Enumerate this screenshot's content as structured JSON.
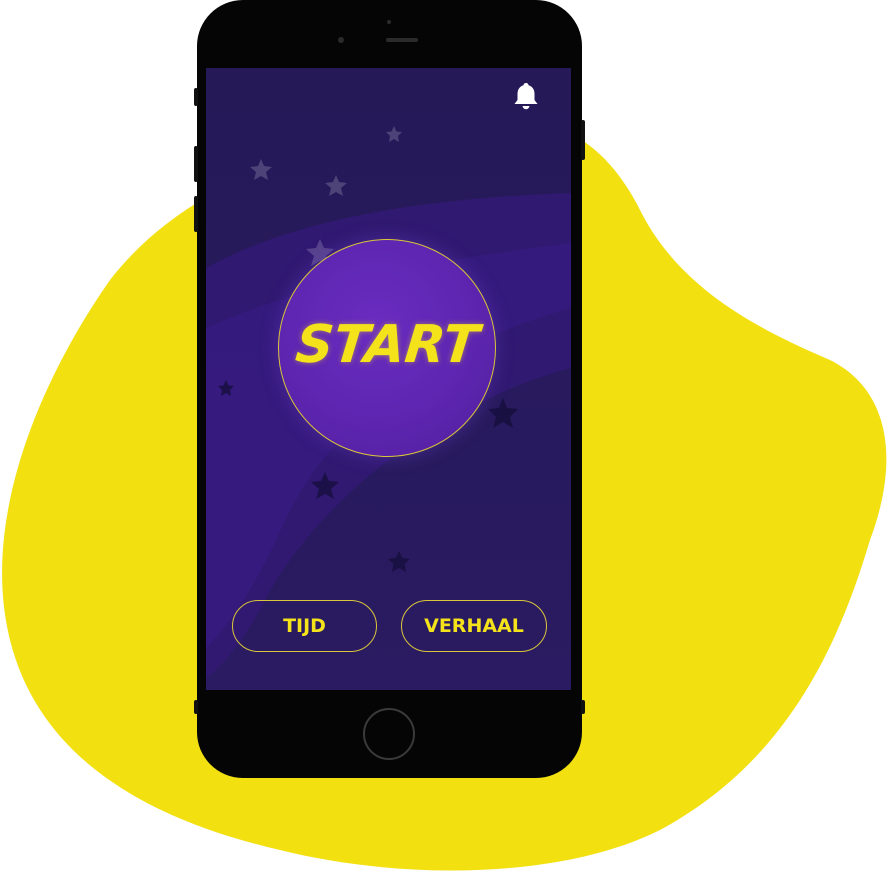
{
  "app": {
    "background_accent": "#f2e011",
    "screen_color": "#261a5c",
    "text_color": "#f4e21a"
  },
  "header": {
    "notification_icon": "bell-icon"
  },
  "main": {
    "start_label": "START"
  },
  "footer_buttons": [
    {
      "label": "TIJD"
    },
    {
      "label": "VERHAAL"
    }
  ],
  "device": {
    "home_button_icon": "home-button"
  }
}
